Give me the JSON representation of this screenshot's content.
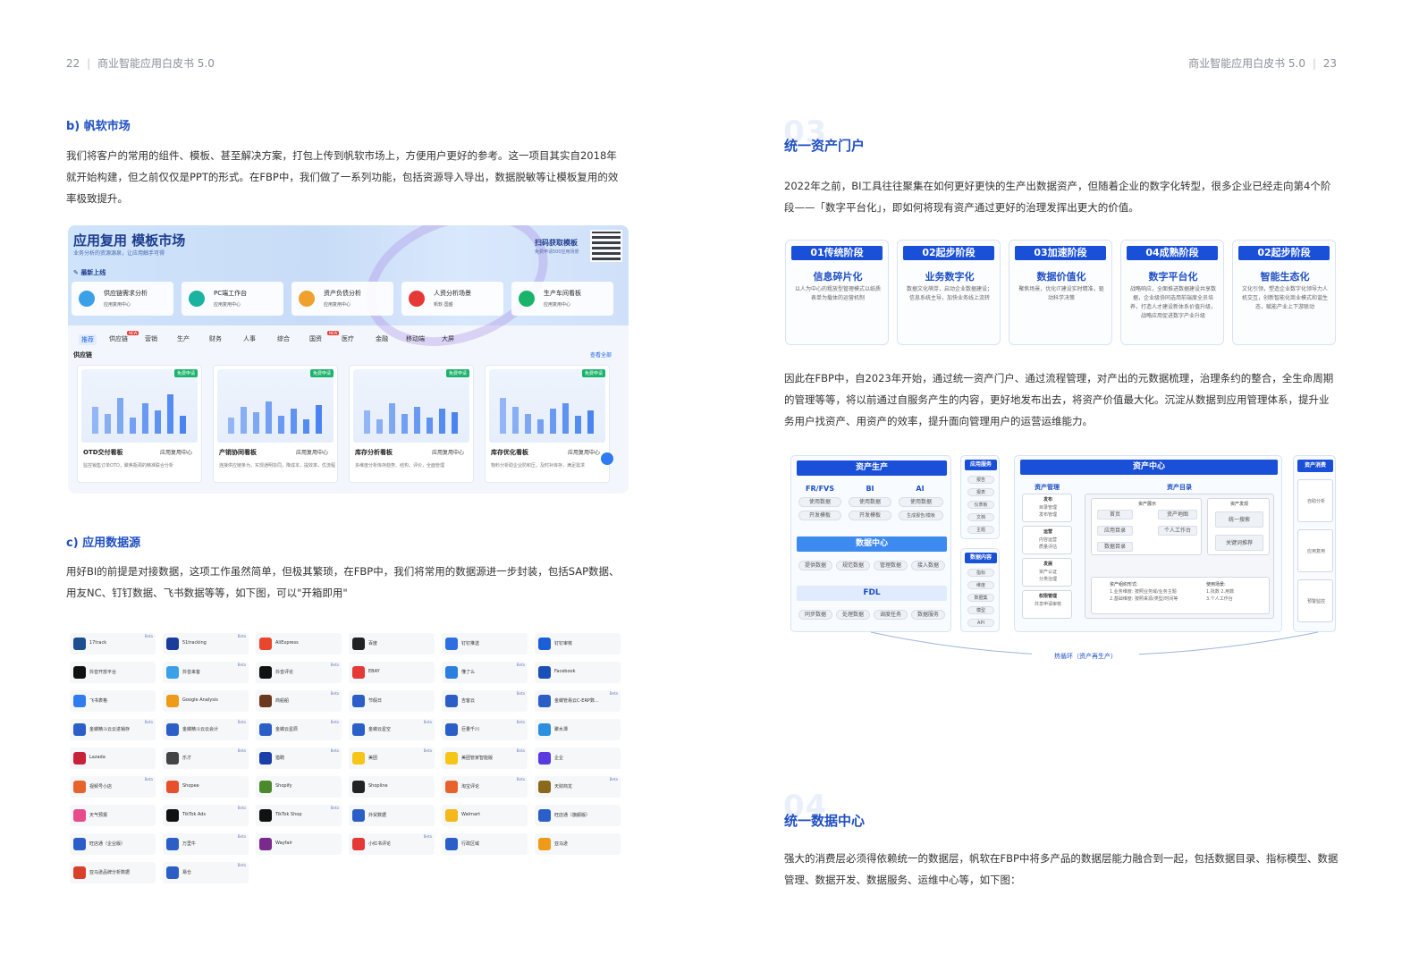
{
  "header": {
    "left_page_no": "22",
    "left_title": "商业智能应用白皮书 5.0",
    "right_title": "商业智能应用白皮书 5.0",
    "right_page_no": "23"
  },
  "left": {
    "market": {
      "heading": "b) 帆软市场",
      "paragraph": "我们将客户的常用的组件、模板、甚至解决方案，打包上传到帆软市场上，方便用户更好的参考。这一项目其实自2018年就开始构建，但之前仅仅是PPT的形式。在FBP中，我们做了一系列功能，包括资源导入导出，数据脱敏等让模板复用的效率极致提升。",
      "image": {
        "title": "应用复用  模板市场",
        "subtitle": "业务分析的资源源泉，让应用触手可得",
        "scan": "扫码获取模板",
        "scan_sub": "免费申请500应用场景",
        "latest": "最新上线",
        "cards": [
          {
            "name": "供应链需求分析",
            "tag": "应用复用中心"
          },
          {
            "name": "PC端工作台",
            "tag": "应用复用中心"
          },
          {
            "name": "资产负债分析",
            "tag": "应用复用中心"
          },
          {
            "name": "人资分析场景",
            "tag": "帆软·国盛"
          },
          {
            "name": "生产车间看板",
            "tag": "应用复用中心"
          }
        ],
        "tabs": [
          "推荐",
          "供应链",
          "营销",
          "生产",
          "财务",
          "人事",
          "综合",
          "国资",
          "医疗",
          "金融",
          "移动端",
          "大屏"
        ],
        "new_badge": "NEW",
        "category": "供应链",
        "view_all": "查看全部",
        "free_badge": "免费申请",
        "tiles": [
          {
            "name": "OTD交付看板",
            "center": "应用复用中心",
            "desc": "监控销售订单OTD，聚焦瓶颈的精准联合分析"
          },
          {
            "name": "产销协同看板",
            "center": "应用复用中心",
            "desc": "连接供应链条为，实现通明协同，降成本，提效率，优流程"
          },
          {
            "name": "库存分析看板",
            "center": "应用复用中心",
            "desc": "多维度分析库存趋势、结构、评价，全面管理"
          },
          {
            "name": "库存优化看板",
            "center": "应用复用中心",
            "desc": "物料分析助企业防积压，及时补库存，满足需求"
          }
        ]
      }
    },
    "datasource": {
      "heading": "c) 应用数据源",
      "paragraph": "用好BI的前提是对接数据，这项工作虽然简单，但极其繁琐，在FBP中，我们将常用的数据源进一步封装，包括SAP数据、用友NC、钉钉数据、飞书数据等等，如下图，可以\"开箱即用\"",
      "beta": "Beta",
      "items": [
        {
          "label": "17track",
          "color": "#1d4e8f",
          "beta": true
        },
        {
          "label": "51tracking",
          "color": "#1a3d9c",
          "beta": true
        },
        {
          "label": "AliExpress",
          "color": "#e8472c",
          "beta": false
        },
        {
          "label": "百度",
          "color": "#222222",
          "beta": false
        },
        {
          "label": "钉钉推送",
          "color": "#2d6fe0",
          "beta": false
        },
        {
          "label": "钉钉审核",
          "color": "#1a5fd8",
          "beta": false
        },
        {
          "label": "抖音开放平台",
          "color": "#111111",
          "beta": false
        },
        {
          "label": "抖音来客",
          "color": "#3aa0e8",
          "beta": true
        },
        {
          "label": "抖音评论",
          "color": "#111111",
          "beta": true
        },
        {
          "label": "EBAY",
          "color": "#e53935",
          "beta": false
        },
        {
          "label": "懂了么",
          "color": "#2a7fe0",
          "beta": true
        },
        {
          "label": "Facebook",
          "color": "#1b4fb8",
          "beta": false
        },
        {
          "label": "飞书表格",
          "color": "#2f7cf0",
          "beta": false
        },
        {
          "label": "Google Analysis",
          "color": "#f09a1a",
          "beta": false
        },
        {
          "label": "商船船",
          "color": "#6b3a1e",
          "beta": true
        },
        {
          "label": "节假日",
          "color": "#2b5fc7",
          "beta": false
        },
        {
          "label": "吉客云",
          "color": "#2b5fc7",
          "beta": true
        },
        {
          "label": "金蝶管易云C-ERP数...",
          "color": "#2b5fc7",
          "beta": true
        },
        {
          "label": "金蝶精斗云云进销存",
          "color": "#2b5fc7",
          "beta": true
        },
        {
          "label": "金蝶精斗云云会计",
          "color": "#2b5fc7",
          "beta": true
        },
        {
          "label": "金蝶云星辰",
          "color": "#2b5fc7",
          "beta": true
        },
        {
          "label": "金蝶云星空",
          "color": "#2b5fc7",
          "beta": true
        },
        {
          "label": "巨量千川",
          "color": "#2b5fc7",
          "beta": true
        },
        {
          "label": "聚水潭",
          "color": "#2b8fe0",
          "beta": false
        },
        {
          "label": "Lazada",
          "color": "#c8213a",
          "beta": false
        },
        {
          "label": "乐才",
          "color": "#444444",
          "beta": true
        },
        {
          "label": "猎聘",
          "color": "#1b3fa8",
          "beta": true
        },
        {
          "label": "美团",
          "color": "#f5c518",
          "beta": true
        },
        {
          "label": "美团管家智能版",
          "color": "#f5c518",
          "beta": true
        },
        {
          "label": "企企",
          "color": "#5a3ae0",
          "beta": false
        },
        {
          "label": "视频号小店",
          "color": "#e8632c",
          "beta": true
        },
        {
          "label": "Shopee",
          "color": "#e8502c",
          "beta": false
        },
        {
          "label": "Shopify",
          "color": "#4a8a2c",
          "beta": false
        },
        {
          "label": "Shopline",
          "color": "#222222",
          "beta": false
        },
        {
          "label": "淘宝评论",
          "color": "#e8632c",
          "beta": true
        },
        {
          "label": "天财商龙",
          "color": "#8a6a1a",
          "beta": true
        },
        {
          "label": "天气预报",
          "color": "#e84a8c",
          "beta": false
        },
        {
          "label": "TikTok Ads",
          "color": "#111111",
          "beta": true
        },
        {
          "label": "TikTok Shop",
          "color": "#111111",
          "beta": true
        },
        {
          "label": "外贸数据",
          "color": "#2b5fc7",
          "beta": false
        },
        {
          "label": "Walmart",
          "color": "#f5b81a",
          "beta": false
        },
        {
          "label": "旺店通（旗舰版）",
          "color": "#2b5fc7",
          "beta": false
        },
        {
          "label": "旺店通（企业版）",
          "color": "#2b5fc7",
          "beta": false
        },
        {
          "label": "万里牛",
          "color": "#2b5fc7",
          "beta": true
        },
        {
          "label": "Wayfair",
          "color": "#7a2a8c",
          "beta": false
        },
        {
          "label": "小红书评论",
          "color": "#e53935",
          "beta": true
        },
        {
          "label": "行政区域",
          "color": "#2b5fc7",
          "beta": false
        },
        {
          "label": "亚马逊",
          "color": "#f09a1a",
          "beta": false
        },
        {
          "label": "亚马逊品牌分析数据",
          "color": "#d8402c",
          "beta": false
        },
        {
          "label": "易仓",
          "color": "#2b5fc7",
          "beta": true
        }
      ]
    }
  },
  "right": {
    "portal": {
      "ghost_no": "03",
      "heading": "统一资产门户",
      "paragraph1": "2022年之前，BI工具往往聚集在如何更好更快的生产出数据资产，但随着企业的数字化转型，很多企业已经走向第4个阶段——「数字平台化」，即如何将现有资产通过更好的治理发挥出更大的价值。",
      "stages": [
        {
          "head": "01传统阶段",
          "title": "信息碎片化",
          "desc": "以人为中心的粗放型管理模式以纸质表单为载体的运营机制"
        },
        {
          "head": "02起步阶段",
          "title": "业务数字化",
          "desc": "数据文化萌芽，启动企业数据建设；信息系统主导，加快业务线上流转"
        },
        {
          "head": "03加速阶段",
          "title": "数据价值化",
          "desc": "聚焦场景，优化IT建设实时精准，驱动科学决策"
        },
        {
          "head": "04成熟阶段",
          "title": "数字平台化",
          "desc": "战略响应，全面推进数据建设共享数据，企业级协同选用前端度全员培养，打造人才建设新体系价值升级，战略应用促进数字产业升级"
        },
        {
          "head": "02起步阶段",
          "title": "智能生态化",
          "desc": "文化引领，塑造企业数字化领导力人机交互，创新智能化商业模式和谐生态，赋能产业上下游联动"
        }
      ],
      "paragraph2": "因此在FBP中，自2023年开始，通过统一资产门户、通过流程管理，对产出的元数据梳理，治理条约的整合，全生命周期的管理等等，将以前通过自服务产生的内容，更好地发布出去，将资产价值最大化。沉淀从数据到应用管理体系，提升业务用户找资产、用资产的效率，提升面向管理用户的运营运维能力。",
      "diagram": {
        "production": "资产生产",
        "col_fr": "FR/FVS",
        "col_bi": "BI",
        "col_ai": "AI",
        "fr_pills": [
          "使用数据",
          "开发模板"
        ],
        "bi_pills": [
          "使用数据",
          "开发模板"
        ],
        "ai_pills": [
          "使用数据",
          "生成报告/模板"
        ],
        "data_center": "数据中心",
        "dc_pills": [
          "提供数据",
          "规范数据",
          "管理数据",
          "接入数据"
        ],
        "fdl": "FDL",
        "fdl_pills": [
          "同步数据",
          "处理数据",
          "调度任务",
          "数据服务"
        ],
        "app_service": "应用服务",
        "app_pills": [
          "报告",
          "报表",
          "仪表板",
          "文档",
          "主题"
        ],
        "data_content": "数据内容",
        "content_pills": [
          "指标",
          "维度",
          "数据集",
          "模型",
          "API"
        ],
        "asset_center": "资产中心",
        "asset_mgmt": "资产管理",
        "mgmt_groups": [
          {
            "title": "发布",
            "items": [
              "目录管理",
              "发布管理"
            ]
          },
          {
            "title": "运营",
            "items": [
              "内容运营",
              "质量评估"
            ]
          },
          {
            "title": "发展",
            "items": [
              "资产认证",
              "分类治理"
            ]
          },
          {
            "title": "权限管理",
            "items": [
              "共享申请审核"
            ]
          }
        ],
        "asset_catalog": "资产目录",
        "asset_show": "资产展示",
        "show_items": [
          "首页",
          "应用目录",
          "数据目录",
          "资产地图",
          "个人工作台"
        ],
        "asset_find": "资产发现",
        "find_items": [
          "统一搜索",
          "关键词推荐"
        ],
        "org_title": "资产组织形式:",
        "org_lines": [
          "1.业务维度: 按照业务域/业务主题",
          "2.基础维度: 按照来源/类型/时间等"
        ],
        "use_title": "使用场景:",
        "use_lines": [
          "1.找数  2.用数",
          "3.个人工作台"
        ],
        "asset_consume": "资产消费",
        "consume_items": [
          "自助分析",
          "应用复用",
          "预警监控"
        ],
        "loop": "热循环（资产再生产）"
      }
    },
    "datacenter": {
      "ghost_no": "04",
      "heading": "统一数据中心",
      "paragraph": "强大的消费层必须得依赖统一的数据层，帆软在FBP中将多产品的数据层能力融合到一起，包括数据目录、指标模型、数据管理、数据开发、数据服务、运维中心等，如下图："
    }
  },
  "colors": {
    "accent": "#1f4fc4",
    "header_blue": "#1a4fd8"
  }
}
